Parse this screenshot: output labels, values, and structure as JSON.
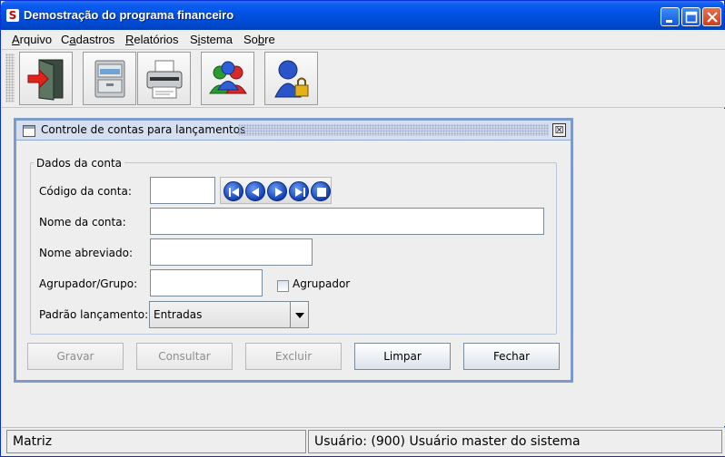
{
  "window": {
    "title": "Demostração do programa financeiro",
    "app_icon": "S"
  },
  "title_buttons": {
    "minimize_icon": "minimize-icon",
    "maximize_icon": "maximize-icon",
    "close_icon": "close-icon"
  },
  "menu": [
    {
      "label": "Arquivo",
      "mnemonic_index": 0
    },
    {
      "label": "Cadastros",
      "mnemonic_index": 1
    },
    {
      "label": "Relatórios",
      "mnemonic_index": 0
    },
    {
      "label": "Sistema",
      "mnemonic_index": 1
    },
    {
      "label": "Sobre",
      "mnemonic_index": 2
    }
  ],
  "toolbar": {
    "tools": [
      {
        "name": "exit-door-icon"
      },
      {
        "name": "file-cabinet-icon"
      },
      {
        "name": "printer-icon"
      },
      {
        "name": "users-group-icon"
      },
      {
        "name": "user-lock-icon"
      }
    ]
  },
  "internal_frame": {
    "title": "Controle de contas para lançamentos",
    "close_glyph": "☒",
    "group_title": "Dados da conta",
    "labels": {
      "codigo": "Código da conta:",
      "nome": "Nome da conta:",
      "abreviado": "Nome abreviado:",
      "agrupador": "Agrupador/Grupo:",
      "padrao": "Padrão lançamento:"
    },
    "fields": {
      "codigo": "",
      "nome": "",
      "abreviado": "",
      "agrupador": ""
    },
    "checkbox": {
      "label": "Agrupador",
      "checked": false
    },
    "combo": {
      "selected": "Entradas"
    },
    "nav_buttons": [
      "first-record-icon",
      "previous-record-icon",
      "next-record-icon",
      "last-record-icon",
      "stop-icon"
    ],
    "buttons": {
      "gravar": {
        "label": "Gravar",
        "enabled": false
      },
      "consultar": {
        "label": "Consultar",
        "enabled": false
      },
      "excluir": {
        "label": "Excluir",
        "enabled": false
      },
      "limpar": {
        "label": "Limpar",
        "enabled": true
      },
      "fechar": {
        "label": "Fechar",
        "enabled": true
      }
    }
  },
  "status": {
    "left": "Matriz",
    "right": "Usuário: (900) Usuário master do sistema"
  },
  "colors": {
    "title_blue": "#0051DF",
    "frame_border": "#7C9ACB",
    "background": "#EEEEEE"
  }
}
